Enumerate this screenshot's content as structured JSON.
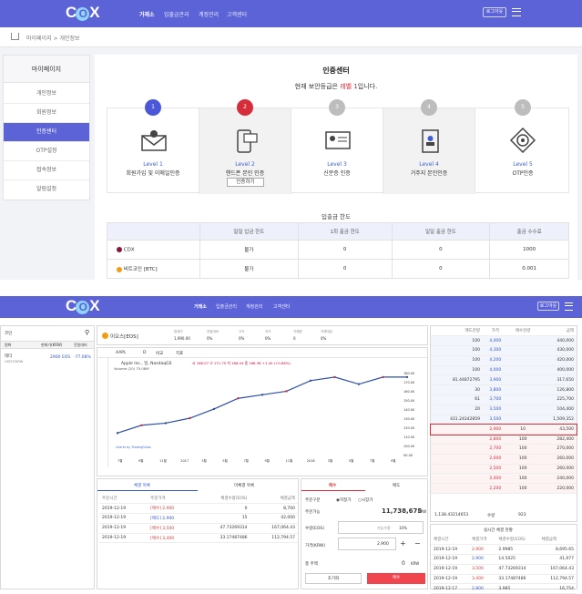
{
  "header": {
    "logo": "CDX",
    "nav": [
      "거래소",
      "입출금관리",
      "계정관리",
      "고객센터"
    ],
    "btn": "로그아웃"
  },
  "breadcrumb": "마이페이지 > 개인정보",
  "sidebar": {
    "title": "마이페이지",
    "items": [
      "개인정보",
      "회원정보",
      "인증센터",
      "OTP설정",
      "접속정보",
      "알림설정"
    ],
    "active": 2
  },
  "cert": {
    "title": "인증센터",
    "subtitle_pre": "현재 보안등급은 ",
    "level_word": "레벨 1",
    "subtitle_post": "입니다.",
    "levels": [
      {
        "num": "1",
        "title": "Level 1",
        "desc": "회원가입 및 이메일인증",
        "icon": "envelope-icon",
        "color": "#4a57d6"
      },
      {
        "num": "2",
        "title": "Level 2",
        "desc": "핸드폰 본인 인증",
        "icon": "phone-icon",
        "color": "#d62d3a",
        "btn": "인증하기"
      },
      {
        "num": "3",
        "title": "Level 3",
        "desc": "신분증 인증",
        "icon": "id-card-icon",
        "color": "#bdbdbd"
      },
      {
        "num": "4",
        "title": "Level 4",
        "desc": "거주지 본인인증",
        "icon": "address-book-icon",
        "color": "#bdbdbd"
      },
      {
        "num": "5",
        "title": "Level 5",
        "desc": "OTP인증",
        "icon": "otp-icon",
        "color": "#bdbdbd"
      }
    ]
  },
  "limits": {
    "title": "입출금 한도",
    "headers": [
      "",
      "일일 입금 한도",
      "1회 출금 한도",
      "일일 출금 한도",
      "출금 수수료"
    ],
    "rows": [
      [
        "CDX",
        "불가",
        "0",
        "0",
        "1000"
      ],
      [
        "비트코인 [BTC]",
        "불가",
        "0",
        "0",
        "0.001"
      ]
    ]
  },
  "trade": {
    "header": {
      "logo": "CDX",
      "nav": [
        "거래소",
        "입출금관리",
        "계정관리",
        "고객센터"
      ],
      "btn": "로그아웃"
    },
    "coin_list": {
      "search_label": "코인",
      "tabs": [
        "원화",
        "현재가(KRW)",
        "전일대비"
      ],
      "item": {
        "name": "테더",
        "sub": "USDT/KRW",
        "price": "2900 EOS",
        "change": "-77.08%"
      }
    },
    "ticker": {
      "name": "이오스[EOS]",
      "stats": [
        [
          "현재가",
          "1,990.00"
        ],
        [
          "전일대비",
          "0%"
        ],
        [
          "고가",
          "0%"
        ],
        [
          "저가",
          "0%"
        ],
        [
          "거래량",
          "0"
        ],
        [
          "거래대금",
          "0%"
        ]
      ]
    },
    "chart_toolbar": {
      "symbol": "AAPL",
      "items": [
        "D",
        "비교",
        "지표"
      ]
    },
    "chart_title": "Apple Inc., 일, NasdaqGS",
    "chart_ohlc": "시 168.07 고 171.75 저 166.44 종 168.38 +1.40 (+0.86%)",
    "chart_volume": "Volume (20) 75.08M",
    "chart_xaxis": [
      "7월",
      "9월",
      "11월",
      "2017",
      "3월",
      "5월",
      "7월",
      "9월",
      "11월",
      "2018",
      "3월",
      "5월",
      "7월",
      "9월"
    ],
    "chart_yaxis": [
      "180.00",
      "170.00",
      "160.00",
      "150.00",
      "140.00",
      "130.00",
      "120.00",
      "110.00",
      "100.00",
      "90.00"
    ],
    "chart_credit": "charts by TradingView",
    "chart_data": {
      "type": "line",
      "x": [
        "2016-07",
        "2016-09",
        "2016-11",
        "2017-01",
        "2017-03",
        "2017-05",
        "2017-07",
        "2017-09",
        "2017-11",
        "2018-01",
        "2018-03",
        "2018-05",
        "2018-07"
      ],
      "values": [
        96,
        107,
        110,
        117,
        130,
        145,
        150,
        155,
        170,
        175,
        165,
        175,
        175
      ],
      "ylim": [
        90,
        180
      ]
    },
    "fills_tabs": [
      "체결 목록",
      "미체결 목록"
    ],
    "fills_headers": [
      "주문시간",
      "주문가격",
      "체결수량(EOS)",
      "체결금액"
    ],
    "fills": [
      [
        "2019-12-19",
        "[매수] 2,900",
        "0",
        "8,700"
      ],
      [
        "2019-12-19",
        "[매도] 2,900",
        "15",
        "42,000"
      ],
      [
        "2019-12-19",
        "[매수] 3,500",
        "47.73269314",
        "167,064.43"
      ],
      [
        "2019-12-19",
        "[매수] 3,400",
        "33.17487486",
        "112,794.57"
      ]
    ],
    "order": {
      "tabs": [
        "매수",
        "매도"
      ],
      "type_label": "주문구분",
      "type_opts": [
        "지정가",
        "시장가"
      ],
      "avail_label": "주문가능",
      "avail": "11,738,675",
      "avail_unit": "KRW",
      "qty_label": "수량(EOS)",
      "qty_btn": "가능수량",
      "pct": "10%",
      "price_label": "가격(KRW)",
      "price": "2,900",
      "total_label": "총 주액",
      "total": "0",
      "total_unit": "KRW",
      "reset": "초기화",
      "submit": "매수"
    },
    "orderbook": {
      "headers": [
        "매도잔량",
        "가격",
        "매수잔량",
        "금액"
      ],
      "rows": [
        [
          "100",
          "4,400",
          "",
          "440,000"
        ],
        [
          "100",
          "4,300",
          "",
          "430,000"
        ],
        [
          "100",
          "4,200",
          "",
          "420,000"
        ],
        [
          "100",
          "4,000",
          "",
          "400,000"
        ],
        [
          "81.44872795",
          "3,900",
          "",
          "317,650"
        ],
        [
          "30",
          "3,800",
          "",
          "126,800"
        ],
        [
          "61",
          "3,700",
          "",
          "225,700"
        ],
        [
          "20",
          "3,500",
          "",
          "104,400"
        ],
        [
          "431.24342859",
          "3,500",
          "",
          "1,509,352"
        ],
        [
          "",
          "2,900",
          "10",
          "43,500"
        ],
        [
          "",
          "2,800",
          "100",
          "282,400"
        ],
        [
          "",
          "2,700",
          "100",
          "270,000"
        ],
        [
          "",
          "2,600",
          "100",
          "260,000"
        ],
        [
          "",
          "2,500",
          "100",
          "260,000"
        ],
        [
          "",
          "2,400",
          "100",
          "240,000"
        ],
        [
          "",
          "2,200",
          "100",
          "220,000"
        ]
      ],
      "footer": [
        "1,138.43214653",
        "수량",
        "923"
      ]
    },
    "recent": {
      "title": "실시간 체결 현황",
      "headers": [
        "체결시간",
        "체결가격",
        "체결수량(EOS)",
        "체결금액"
      ],
      "rows": [
        [
          "2019-12-19",
          "2,900",
          "2.9985",
          "8,695.65"
        ],
        [
          "2019-12-19",
          "2,900",
          "14.5025",
          "41,977"
        ],
        [
          "2019-12-19",
          "3,500",
          "47.73269314",
          "167,064.43"
        ],
        [
          "2019-12-19",
          "3,400",
          "33.17487486",
          "112,794.57"
        ],
        [
          "2019-12-17",
          "2,800",
          "3.985",
          "16,754"
        ]
      ]
    }
  },
  "colors": {
    "accent": "#5c63d6",
    "red": "#d62d3a",
    "blue": "#3156c8"
  }
}
